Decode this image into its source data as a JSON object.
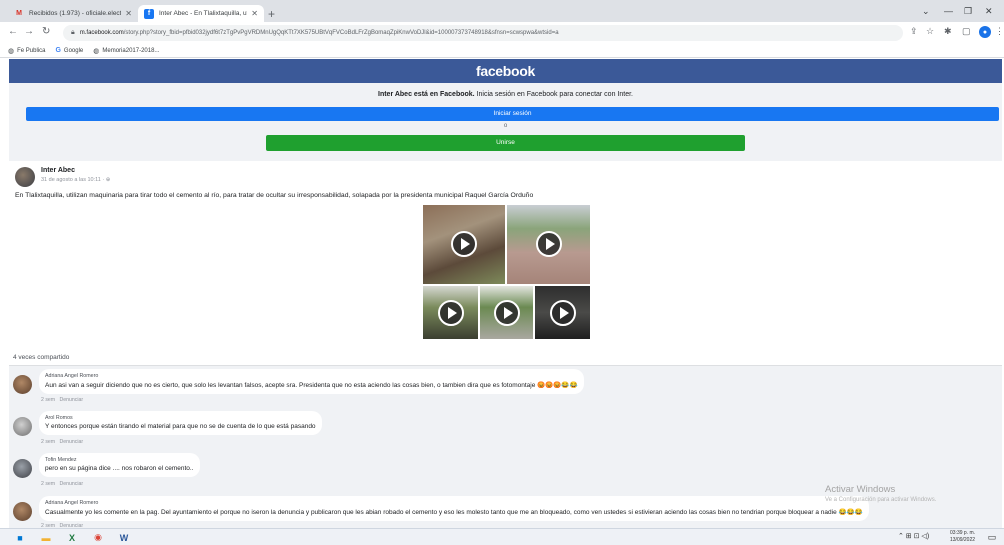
{
  "browser": {
    "tabs": [
      {
        "title": "Recibidos (1.973) - oficiale.elect.",
        "icon": "gmail-icon",
        "active": false
      },
      {
        "title": "Inter Abec - En Tlalixtaquilla, utili.",
        "icon": "facebook-icon",
        "active": true
      }
    ],
    "new_tab_label": "+",
    "url_host": "m.facebook.com",
    "url_path": "/story.php?story_fbid=pfbid032jydf6t7zTgPvPgVRDMnUgQqKTt7XK575UBtVqFVCoBdLFrZgBomaqZpiKnwVoDJl&id=100007373748918&sfnsn=scwspwa&wtsid=a",
    "bookmarks": [
      {
        "label": "Fe Publica",
        "icon": "globe-icon"
      },
      {
        "label": "Google",
        "icon": "google-icon"
      },
      {
        "label": "Memoria2017-2018...",
        "icon": "globe-icon"
      }
    ]
  },
  "facebook": {
    "logo": "facebook",
    "promo_page": "Inter Abec está en Facebook.",
    "promo_rest": " Inicia sesión en Facebook para conectar con Inter.",
    "login_label": "Iniciar sesión",
    "or_label": "o",
    "join_label": "Unirse"
  },
  "post": {
    "author": "Inter Abec",
    "time": "31 de agosto a las 10:11 · ⊕",
    "body": "En Tlalixtaquilla, utilizan maquinaria para tirar todo el cemento al río, para tratar de ocultar su irresponsabilidad, solapada por la presidenta municipal Raquel García Orduño",
    "shares": "4 veces compartido"
  },
  "comments": [
    {
      "name": "Adriana Angel Romero",
      "text": "Aun asi van a seguir diciendo que no es cierto, que solo les levantan falsos, acepte sra. Presidenta que no esta aciendo las cosas bien, o tambien dira que es fotomontaje",
      "emoji": "😡😡😡😂😂",
      "time": "2 sem",
      "report": "Denunciar"
    },
    {
      "name": "Arol Romos",
      "text": "Y entonces porque están tirando el material para que no se de cuenta de lo que está pasando",
      "emoji": "",
      "time": "2 sem",
      "report": "Denunciar"
    },
    {
      "name": "Tofin Mendez",
      "text": "pero en su página dice .... nos robaron el cemento..",
      "emoji": "",
      "time": "2 sem",
      "report": "Denunciar"
    },
    {
      "name": "Adriana Angel Romero",
      "text": "Casualmente yo les comente en la pag. Del ayuntamiento el porque no iseron la denuncia y publicaron que les abian robado el cemento y eso les molesto tanto que me an bloqueado, como ven ustedes si estivieran aciendo las cosas bien no tendrian porque bloquear a nadie",
      "emoji": "😂😂😂",
      "time": "2 sem",
      "report": "Denunciar"
    }
  ],
  "watermark": {
    "title": "Activar Windows",
    "subtitle": "Ve a Configuración para activar Windows."
  },
  "taskbar": {
    "time": "03:39 p. m.",
    "date": "13/09/2022"
  }
}
